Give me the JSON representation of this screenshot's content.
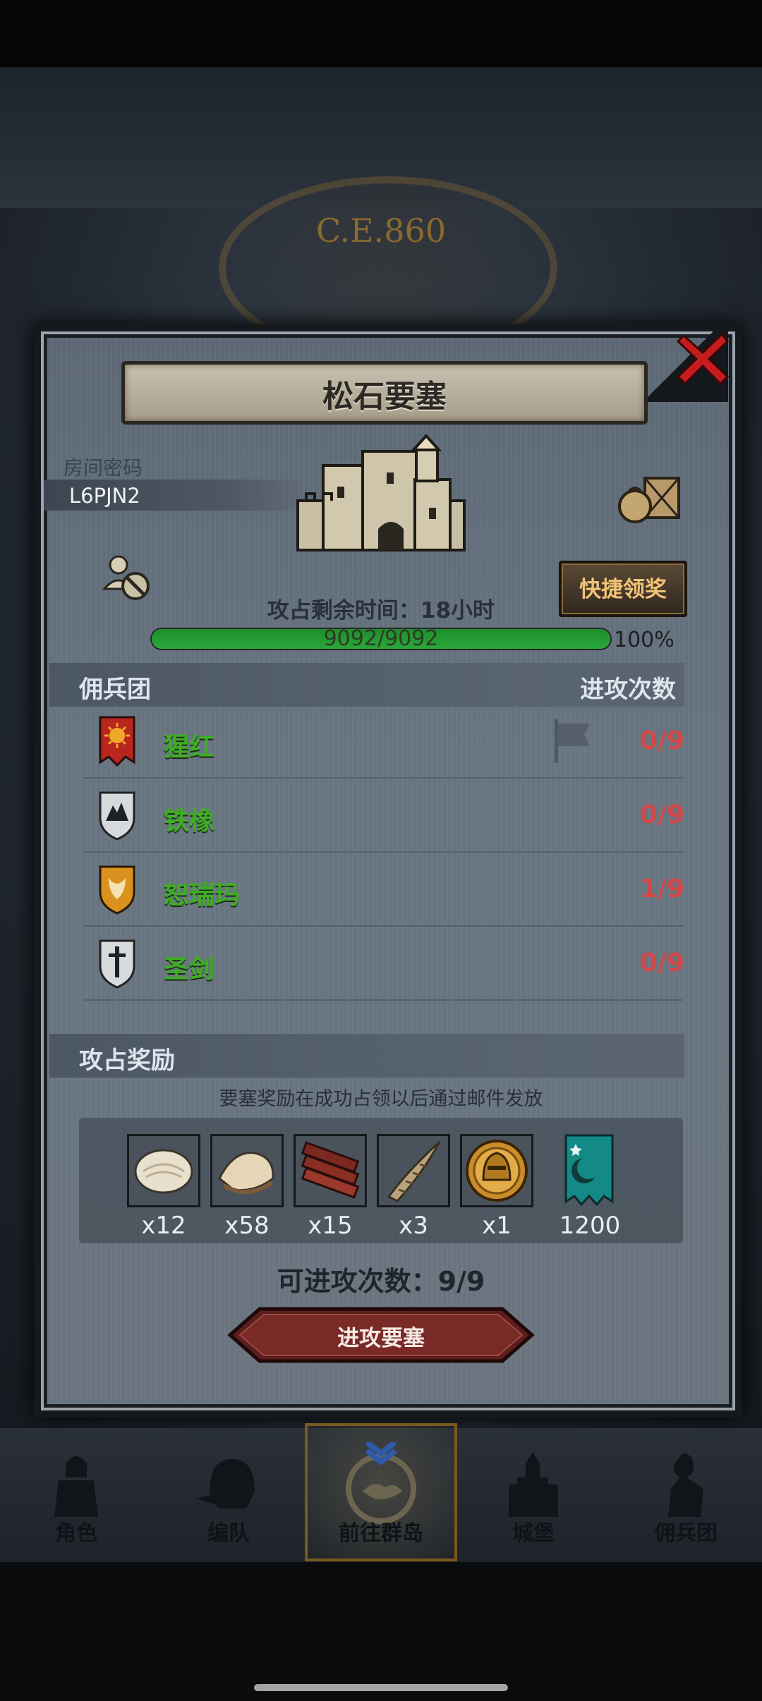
{
  "header": {
    "era": "C.E.860"
  },
  "dialog": {
    "title": "松石要塞",
    "room_label": "房间密码",
    "room_code": "L6PJN2",
    "claim_button": "快捷领奖",
    "time_label": "攻占剩余时间：",
    "time_value": "18小时",
    "hp_text": "9092/9092",
    "hp_percent": "100%",
    "hp_fraction": 1.0
  },
  "mercenaries": {
    "title": "佣兵团",
    "attack_header": "进攻次数",
    "rows": [
      {
        "name": "猩红",
        "count": "0/9",
        "icon": "red-sun-banner-icon"
      },
      {
        "name": "铁橡",
        "count": "0/9",
        "icon": "iron-mountain-shield-icon"
      },
      {
        "name": "恕瑞玛",
        "count": "1/9",
        "icon": "gold-sun-shield-icon"
      },
      {
        "name": "圣剑",
        "count": "0/9",
        "icon": "sword-shield-icon"
      }
    ]
  },
  "rewards": {
    "title": "攻占奖励",
    "note": "要塞奖励在成功占领以后通过邮件发放",
    "items": [
      {
        "icon": "raw-hide-icon",
        "qty": "x12"
      },
      {
        "icon": "fur-pelt-icon",
        "qty": "x58"
      },
      {
        "icon": "wood-planks-icon",
        "qty": "x15"
      },
      {
        "icon": "horn-icon",
        "qty": "x3"
      },
      {
        "icon": "golden-helmet-coin-icon",
        "qty": "x1"
      },
      {
        "icon": "guild-banner-icon",
        "qty": "1200"
      }
    ],
    "attempts": "可进攻次数：9/9",
    "attack_button": "进攻要塞"
  },
  "nav": {
    "items": [
      {
        "label": "角色",
        "icon": "knight-icon"
      },
      {
        "label": "编队",
        "icon": "helmet-icon"
      },
      {
        "label": "前往群岛",
        "icon": "island-compass-icon"
      },
      {
        "label": "城堡",
        "icon": "castle-icon"
      },
      {
        "label": "佣兵团",
        "icon": "mercenary-icon"
      }
    ],
    "active": "前往群岛"
  },
  "colors": {
    "merc_name": "#3fae24",
    "attack_count": "#d24848",
    "claim_text": "#f1c276",
    "hp_bar": "#28a83a"
  }
}
